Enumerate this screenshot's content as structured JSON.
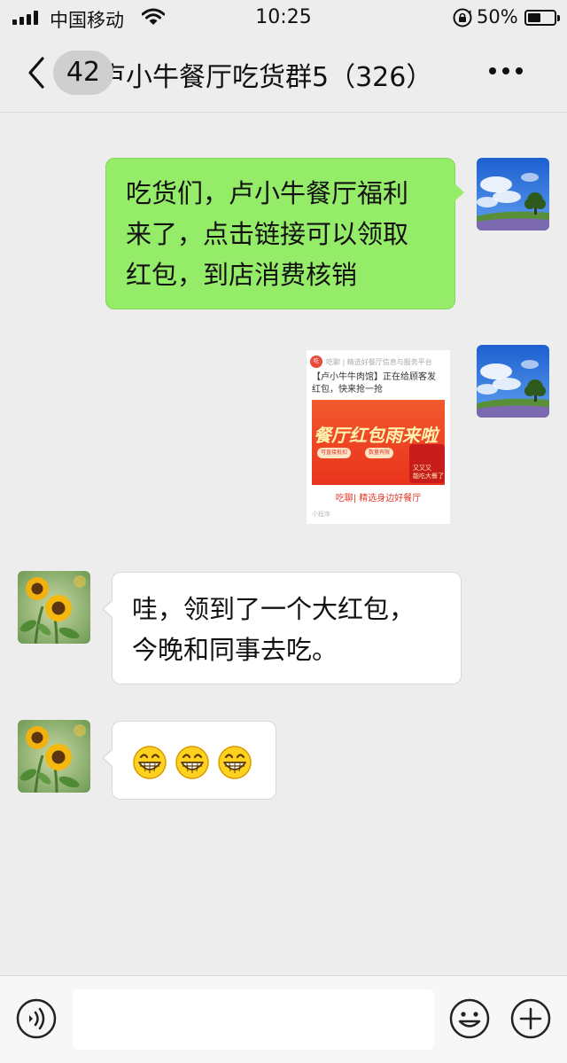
{
  "status_bar": {
    "carrier": "中国移动",
    "time": "10:25",
    "battery_percent": "50%",
    "battery_level": 0.5
  },
  "nav": {
    "unread_count": "42",
    "title": "卢小牛餐厅吃货群5（326）",
    "icons": {
      "back": "chevron-left-icon",
      "more": "more-dots-icon"
    }
  },
  "messages": [
    {
      "side": "right",
      "type": "text",
      "avatar": "sky-landscape-avatar",
      "lines": [
        "吃货们，卢小牛餐厅福利",
        "来了，点击链接可以领取",
        "红包，到店消费核销"
      ]
    },
    {
      "side": "right",
      "type": "share_card",
      "avatar": "sky-landscape-avatar",
      "card": {
        "source": "吃聊 | 精选好餐厅信息与服务平台",
        "text_line1": "【卢小牛牛肉馆】正在给顾客发",
        "text_line2": "红包，快来抢一抢",
        "banner_title": "餐厅红包雨来啦",
        "pill_left": "可直接抵扣",
        "pill_right": "数量有限",
        "envelope_text_1": "又又又",
        "envelope_text_2": "能吃大餐了",
        "slogan": "吃聊| 精选身边好餐厅",
        "footer": "小程序"
      }
    },
    {
      "side": "left",
      "type": "text",
      "avatar": "sunflower-avatar",
      "lines": [
        "哇，领到了一个大红包，",
        "今晚和同事去吃。"
      ]
    },
    {
      "side": "left",
      "type": "emoji",
      "avatar": "sunflower-avatar",
      "emojis": [
        "grin-emoji",
        "grin-emoji",
        "grin-emoji"
      ]
    }
  ],
  "input_bar": {
    "value": "",
    "icons": {
      "voice": "voice-icon",
      "emoji": "emoji-icon",
      "plus": "plus-icon"
    }
  },
  "colors": {
    "background": "#ededed",
    "sent_bubble": "#95ec69",
    "received_bubble": "#ffffff",
    "banner_red": "#e9331c"
  }
}
